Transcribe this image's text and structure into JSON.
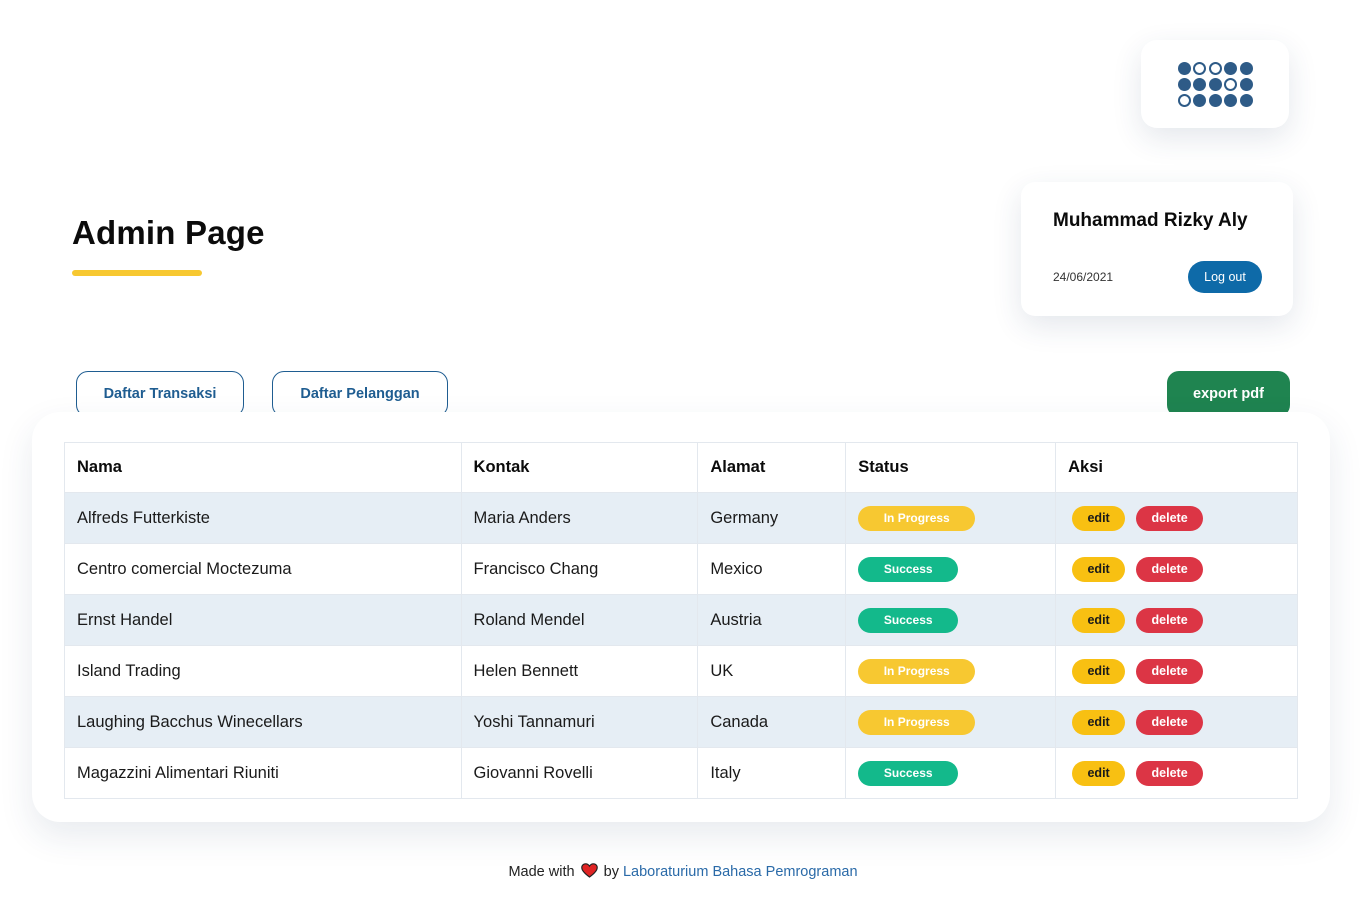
{
  "colors": {
    "accent_yellow": "#f7c831",
    "primary_blue": "#0e6aa8",
    "outline_blue": "#1f5d91",
    "export_green": "#1f8450",
    "success_green": "#13b98b",
    "danger_red": "#dc3545",
    "row_stripe": "#e6eef5"
  },
  "logo": {
    "icon": "dot-grid-logo-icon"
  },
  "header": {
    "title": "Admin Page"
  },
  "user": {
    "name": "Muhammad Rizky Aly",
    "date": "24/06/2021",
    "logout_label": "Log out"
  },
  "nav": {
    "transaksi_label": "Daftar Transaksi",
    "pelanggan_label": "Daftar Pelanggan",
    "export_label": "export pdf"
  },
  "table": {
    "columns": [
      "Nama",
      "Kontak",
      "Alamat",
      "Status",
      "Aksi"
    ],
    "edit_label": "edit",
    "delete_label": "delete",
    "rows": [
      {
        "nama": "Alfreds Futterkiste",
        "kontak": "Maria Anders",
        "alamat": "Germany",
        "status": "In Progress"
      },
      {
        "nama": "Centro comercial Moctezuma",
        "kontak": "Francisco Chang",
        "alamat": "Mexico",
        "status": "Success"
      },
      {
        "nama": "Ernst Handel",
        "kontak": "Roland Mendel",
        "alamat": "Austria",
        "status": "Success"
      },
      {
        "nama": "Island Trading",
        "kontak": "Helen Bennett",
        "alamat": "UK",
        "status": "In Progress"
      },
      {
        "nama": "Laughing Bacchus Winecellars",
        "kontak": "Yoshi Tannamuri",
        "alamat": "Canada",
        "status": "In Progress"
      },
      {
        "nama": "Magazzini Alimentari Riuniti",
        "kontak": "Giovanni Rovelli",
        "alamat": "Italy",
        "status": "Success"
      }
    ]
  },
  "footer": {
    "made_with": "Made with",
    "heart_icon": "heart-icon",
    "by": "by",
    "link_label": "Laboraturium Bahasa Pemrograman"
  }
}
